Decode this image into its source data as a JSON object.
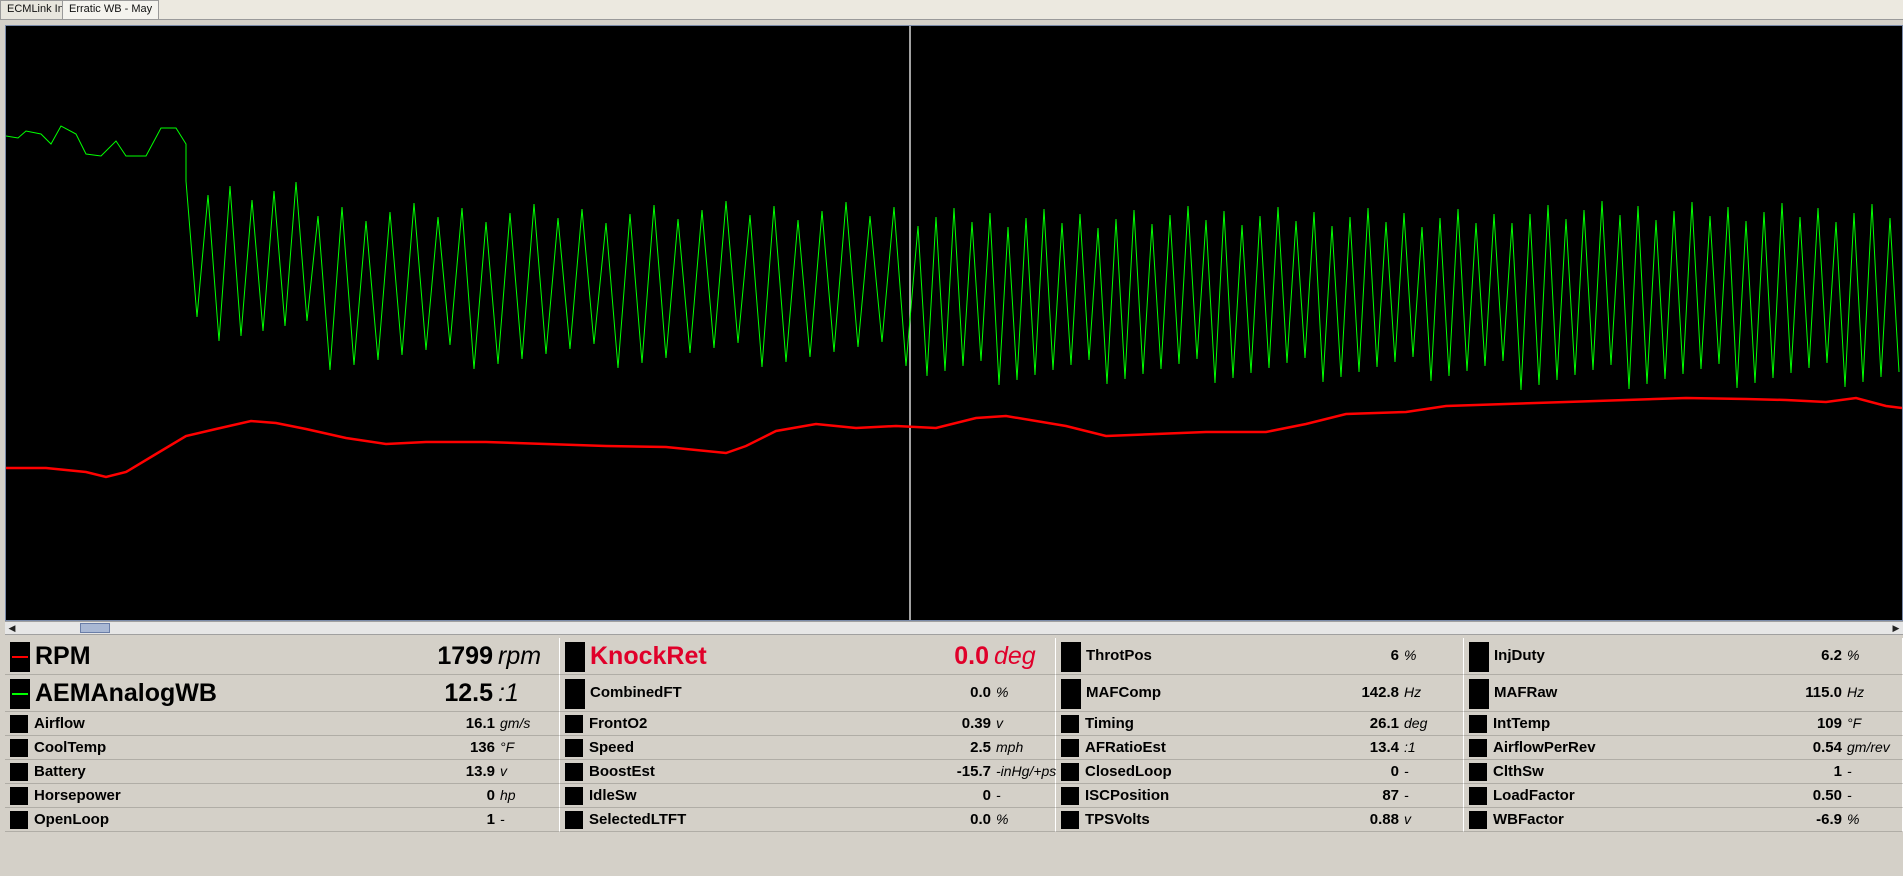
{
  "tabs": [
    {
      "label": "ECMLink Info",
      "active": false
    },
    {
      "label": "Erratic WB - May",
      "active": true
    }
  ],
  "chart_data": {
    "type": "line",
    "title": "",
    "xlabel": "",
    "ylabel": "",
    "cursor_fraction": 0.477,
    "series": [
      {
        "name": "RPM",
        "color": "#ff0000"
      },
      {
        "name": "AEMAnalogWB",
        "color": "#00ff00"
      }
    ]
  },
  "scrollbar": {
    "left_arrow": "◀",
    "right_arrow": "▶"
  },
  "cells": [
    {
      "name": "RPM",
      "value": "1799",
      "unit": "rpm",
      "big": true,
      "color": "#ff0000",
      "line": true,
      "text_color": "#000000"
    },
    {
      "name": "KnockRet",
      "value": "0.0",
      "unit": "deg",
      "big": true,
      "color": "#000000",
      "line": false,
      "text_color": "#e0002a"
    },
    {
      "name": "ThrotPos",
      "value": "6",
      "unit": "%",
      "big": false,
      "color": "#000000",
      "line": false,
      "text_color": "#000000"
    },
    {
      "name": "InjDuty",
      "value": "6.2",
      "unit": "%",
      "big": false,
      "color": "#000000",
      "line": false,
      "text_color": "#000000"
    },
    {
      "name": "AEMAnalogWB",
      "value": "12.5",
      "unit": ":1",
      "big": true,
      "color": "#00ff00",
      "line": true,
      "text_color": "#000000"
    },
    {
      "name": "CombinedFT",
      "value": "0.0",
      "unit": "%",
      "big": false,
      "color": "#000000",
      "line": false,
      "text_color": "#000000"
    },
    {
      "name": "MAFComp",
      "value": "142.8",
      "unit": "Hz",
      "big": false,
      "color": "#000000",
      "line": false,
      "text_color": "#000000"
    },
    {
      "name": "MAFRaw",
      "value": "115.0",
      "unit": "Hz",
      "big": false,
      "color": "#000000",
      "line": false,
      "text_color": "#000000"
    },
    {
      "name": "Airflow",
      "value": "16.1",
      "unit": "gm/s"
    },
    {
      "name": "FrontO2",
      "value": "0.39",
      "unit": "v"
    },
    {
      "name": "Timing",
      "value": "26.1",
      "unit": "deg"
    },
    {
      "name": "IntTemp",
      "value": "109",
      "unit": "°F"
    },
    {
      "name": "CoolTemp",
      "value": "136",
      "unit": "°F"
    },
    {
      "name": "Speed",
      "value": "2.5",
      "unit": "mph"
    },
    {
      "name": "AFRatioEst",
      "value": "13.4",
      "unit": ":1"
    },
    {
      "name": "AirflowPerRev",
      "value": "0.54",
      "unit": "gm/rev"
    },
    {
      "name": "Battery",
      "value": "13.9",
      "unit": "v"
    },
    {
      "name": "BoostEst",
      "value": "-15.7",
      "unit": "-inHg/+psi"
    },
    {
      "name": "ClosedLoop",
      "value": "0",
      "unit": "-"
    },
    {
      "name": "ClthSw",
      "value": "1",
      "unit": "-"
    },
    {
      "name": "Horsepower",
      "value": "0",
      "unit": "hp"
    },
    {
      "name": "IdleSw",
      "value": "0",
      "unit": "-"
    },
    {
      "name": "ISCPosition",
      "value": "87",
      "unit": "-"
    },
    {
      "name": "LoadFactor",
      "value": "0.50",
      "unit": "-"
    },
    {
      "name": "OpenLoop",
      "value": "1",
      "unit": "-"
    },
    {
      "name": "SelectedLTFT",
      "value": "0.0",
      "unit": "%"
    },
    {
      "name": "TPSVolts",
      "value": "0.88",
      "unit": "v"
    },
    {
      "name": "WBFactor",
      "value": "-6.9",
      "unit": "%"
    }
  ]
}
